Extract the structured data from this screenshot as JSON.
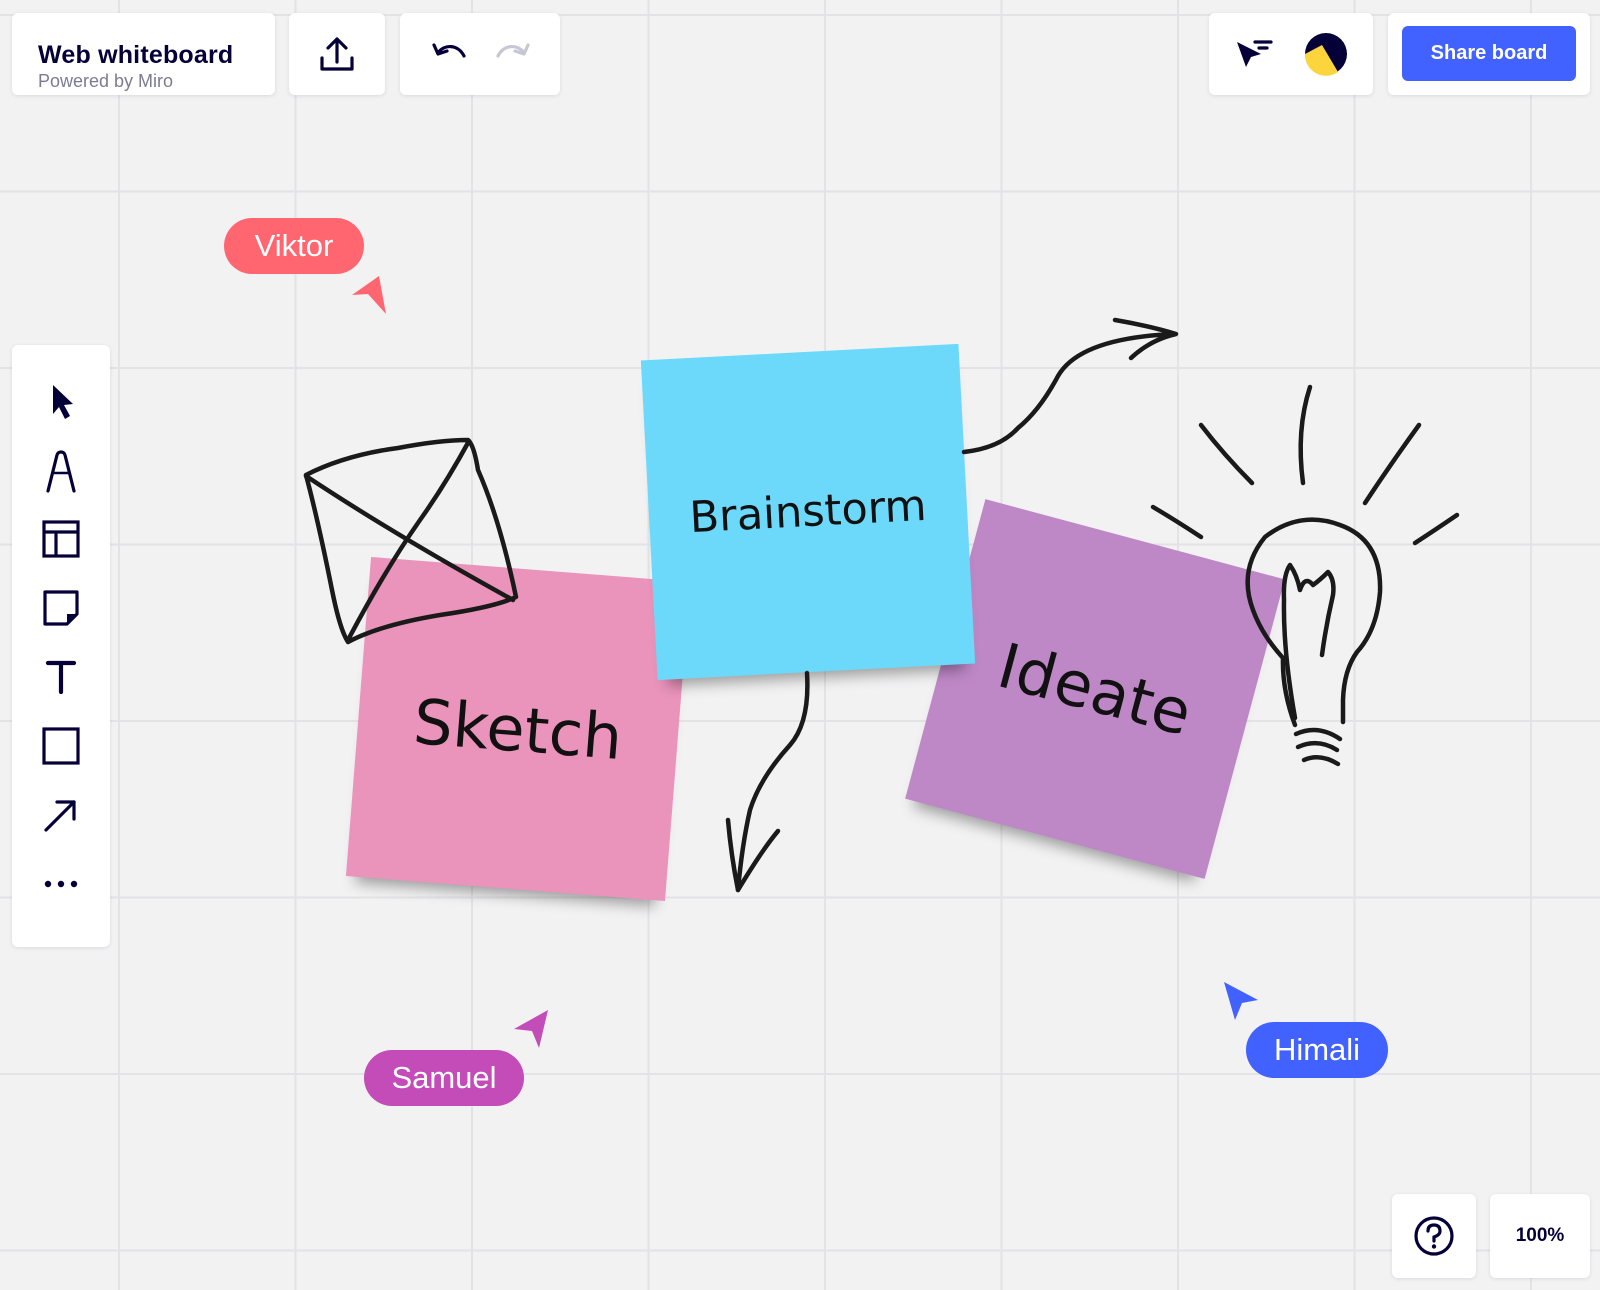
{
  "header": {
    "title": "Web whiteboard",
    "subtitle": "Powered by Miro",
    "export_icon": "upload-icon",
    "undo_icon": "undo-icon",
    "redo_icon": "redo-icon",
    "collaboration_icon": "cursors-icon",
    "avatar_icon": "avatar-icon",
    "share_label": "Share board"
  },
  "toolbar": {
    "tools": [
      "select-tool",
      "pen-tool",
      "templates-tool",
      "sticky-note-tool",
      "text-tool",
      "shape-tool",
      "arrow-tool",
      "more-tool"
    ]
  },
  "canvas": {
    "stickies": [
      {
        "text": "Sketch",
        "color": "#ea94bb"
      },
      {
        "text": "Brainstorm",
        "color": "#6cd8fa"
      },
      {
        "text": "Ideate",
        "color": "#be88c7"
      }
    ],
    "cursors": [
      {
        "name": "Viktor",
        "color": "#ff6670"
      },
      {
        "name": "Samuel",
        "color": "#c34cb9"
      },
      {
        "name": "Himali",
        "color": "#4262ff"
      }
    ],
    "drawings": [
      "envelope-doodle",
      "curved-arrow-right",
      "curved-arrow-down",
      "lightbulb-doodle"
    ]
  },
  "footer": {
    "help_icon": "help-icon",
    "zoom": "100%"
  },
  "colors": {
    "accent": "#4262ff",
    "ink": "#050038",
    "canvas": "#f2f2f3"
  }
}
